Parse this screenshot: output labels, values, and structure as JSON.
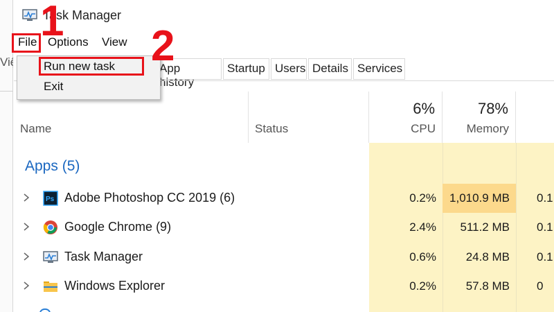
{
  "window": {
    "title": "Task Manager",
    "icon": "task-manager-icon"
  },
  "outer_clip_text": "Việ",
  "menu": {
    "file": "File",
    "options": "Options",
    "view": "View"
  },
  "file_menu": {
    "items": [
      "Run new task",
      "Exit"
    ]
  },
  "tabs": [
    "App history",
    "Startup",
    "Users",
    "Details",
    "Services"
  ],
  "columns": {
    "name": "Name",
    "status": "Status",
    "cpu_pct": "6%",
    "cpu": "CPU",
    "memory_pct": "78%",
    "memory": "Memory"
  },
  "group": {
    "title": "Apps (5)"
  },
  "rows": [
    {
      "name": "Adobe Photoshop CC 2019 (6)",
      "icon": "photoshop-icon",
      "cpu": "0.2%",
      "memory": "1,010.9 MB",
      "disk": "0.1"
    },
    {
      "name": "Google Chrome (9)",
      "icon": "chrome-icon",
      "cpu": "2.4%",
      "memory": "511.2 MB",
      "disk": "0.1"
    },
    {
      "name": "Task Manager",
      "icon": "task-manager-icon",
      "cpu": "0.6%",
      "memory": "24.8 MB",
      "disk": "0.1"
    },
    {
      "name": "Windows Explorer",
      "icon": "folder-icon",
      "cpu": "0.2%",
      "memory": "57.8 MB",
      "disk": "0"
    }
  ],
  "annotations": {
    "step1": "1",
    "step2": "2",
    "highlight_color": "#e8121a"
  },
  "colors": {
    "group_title": "#1a67c0",
    "heat_light": "#fdf3c5",
    "heat_strong": "#fcd98c"
  }
}
